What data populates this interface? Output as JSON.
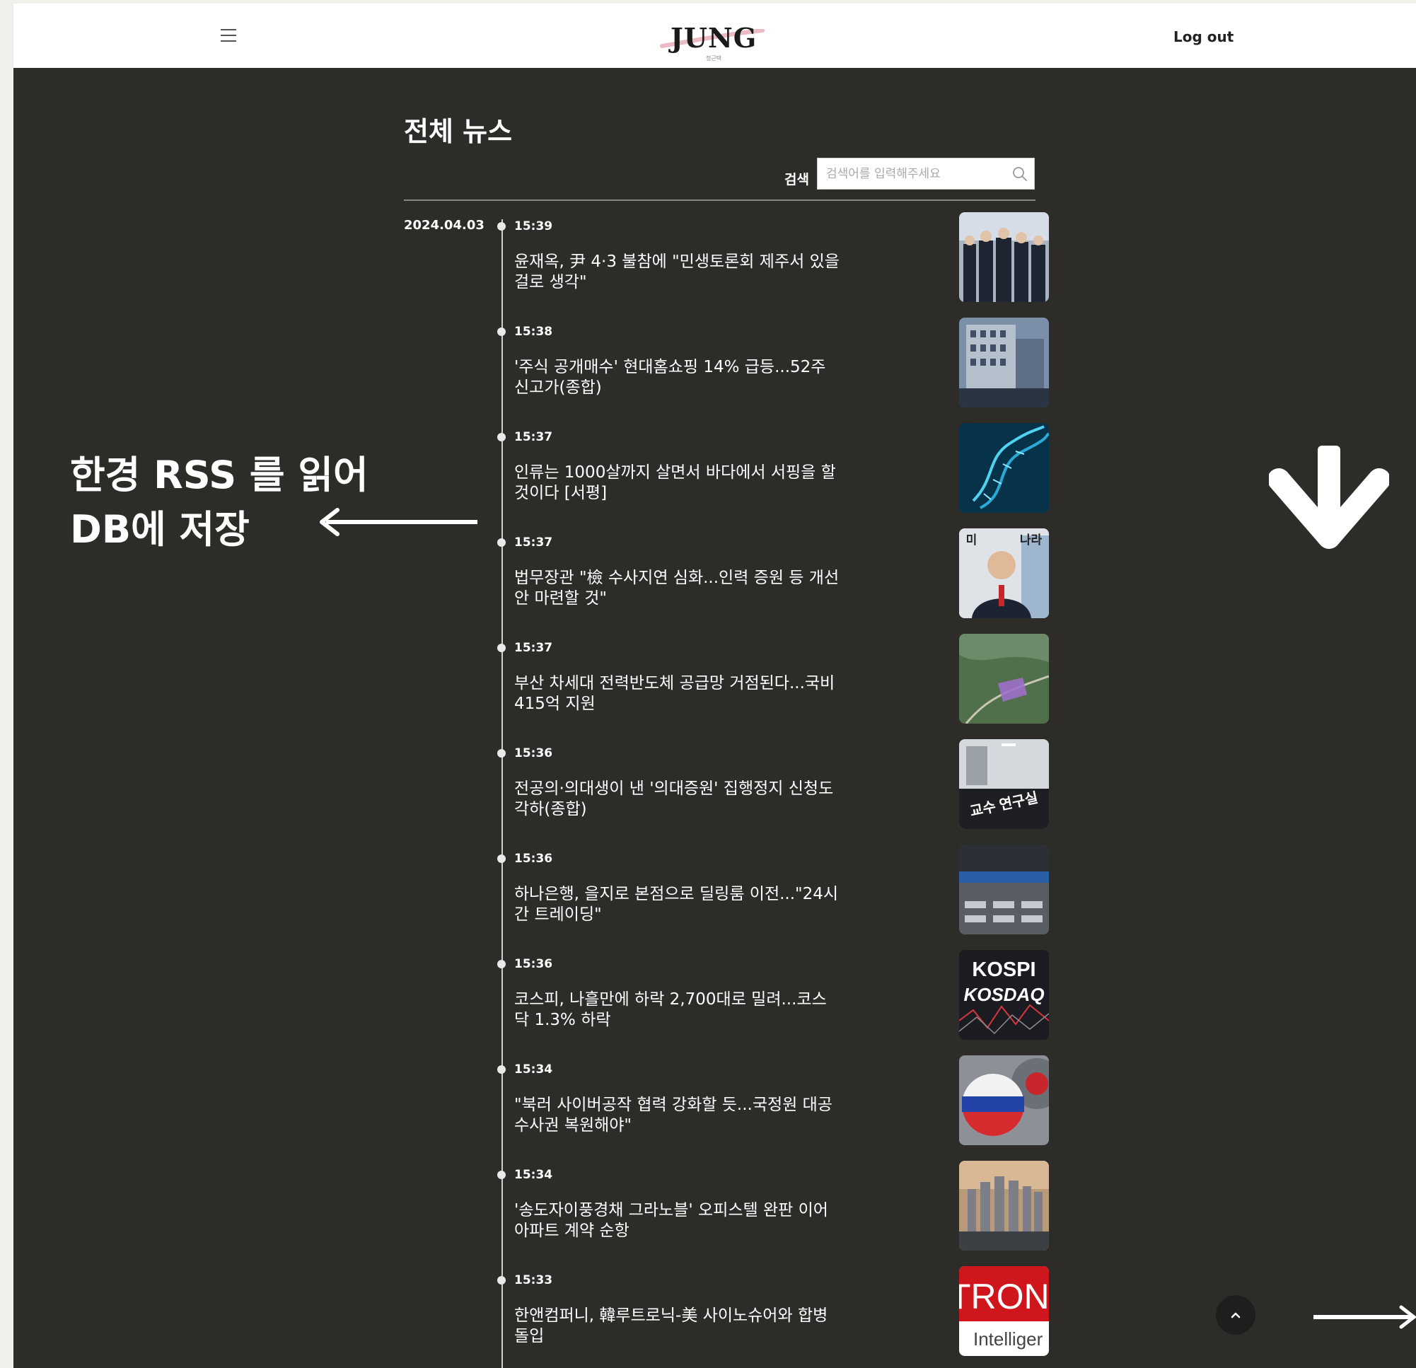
{
  "header": {
    "logo_text": "JUNG",
    "logo_subtext": "정근택",
    "logout_label": "Log out"
  },
  "main": {
    "title": "전체 뉴스",
    "search": {
      "label": "검색",
      "placeholder": "검색어를 입력해주세요"
    },
    "date": "2024.04.03",
    "news": [
      {
        "time": "15:39",
        "headline": "윤재옥, 尹 4·3 불참에 \"민생토론회 제주서 있을 걸로 생각\"",
        "thumb": "officials-standing-photo"
      },
      {
        "time": "15:38",
        "headline": "'주식 공개매수' 현대홈쇼핑 14% 급등...52주 신고가(종합)",
        "thumb": "building-photo"
      },
      {
        "time": "15:37",
        "headline": "인류는 1000살까지 살면서 바다에서 서핑을 할 것이다 [서평]",
        "thumb": "dna-image"
      },
      {
        "time": "15:37",
        "headline": "법무장관 \"檢 수사지연 심화...인력 증원 등 개선안 마련할 것\"",
        "thumb": "minister-photo",
        "thumb_text": [
          "미",
          "나라"
        ]
      },
      {
        "time": "15:37",
        "headline": "부산 차세대 전력반도체 공급망 거점된다...국비 415억 지원",
        "thumb": "aerial-map-photo"
      },
      {
        "time": "15:36",
        "headline": "전공의·의대생이 낸 '의대증원' 집행정지 신청도 각하(종합)",
        "thumb": "hospital-sign-photo",
        "thumb_text": [
          "교수 연구실"
        ]
      },
      {
        "time": "15:36",
        "headline": "하나은행, 을지로 본점으로 딜링룸 이전...\"24시간 트레이딩\"",
        "thumb": "trading-room-photo"
      },
      {
        "time": "15:36",
        "headline": "코스피, 나흘만에 하락 2,700대로 밀려...코스닥 1.3% 하락",
        "thumb": "kospi-chart-image",
        "thumb_text": [
          "KOSPI",
          "KOSDAQ"
        ]
      },
      {
        "time": "15:34",
        "headline": "\"북러 사이버공작 협력 강화할 듯...국정원 대공수사권 복원해야\"",
        "thumb": "russia-flag-gear-image"
      },
      {
        "time": "15:34",
        "headline": "'송도자이풍경채 그라노블' 오피스텔 완판 이어 아파트 계약 순항",
        "thumb": "apartment-render"
      },
      {
        "time": "15:33",
        "headline": "한앤컴퍼니, 韓루트로닉-美 사이노슈어와 합병 돌입",
        "thumb": "lutronic-logo-image",
        "thumb_text": [
          "TRON",
          "Intelliger"
        ]
      }
    ]
  },
  "annotation": {
    "text_line1": "한경 RSS 를 읽어",
    "text_line2": "DB에 저장"
  },
  "colors": {
    "background": "#2e2c29",
    "header_bg": "#ffffff",
    "text": "#ffffff",
    "timeline": "#cfcfcf"
  }
}
